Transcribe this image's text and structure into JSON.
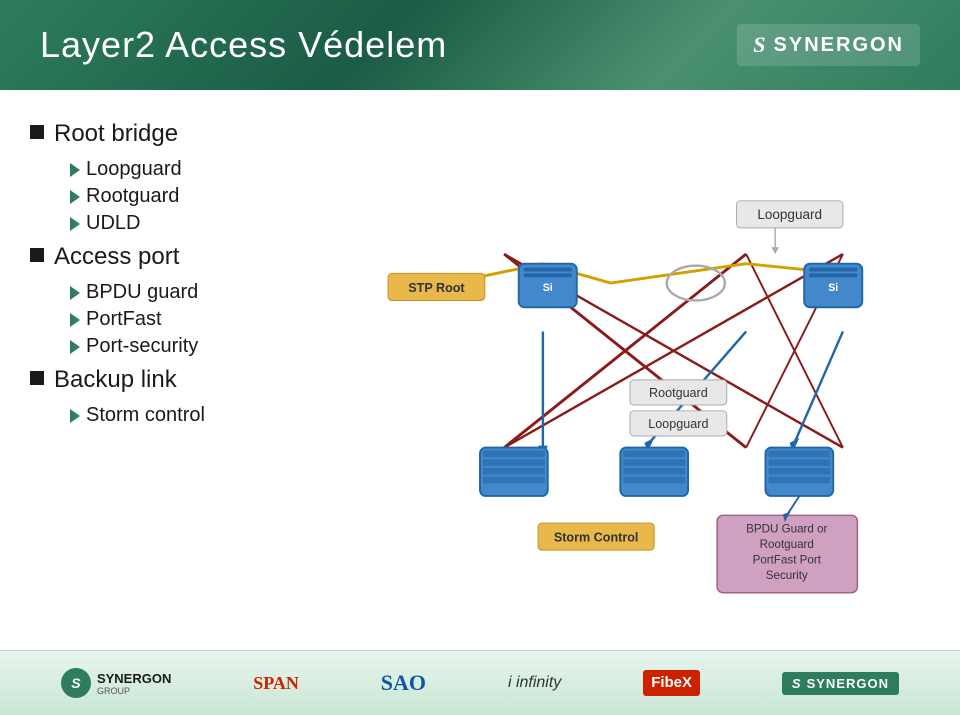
{
  "header": {
    "title": "Layer2 Access Védelem",
    "logo_text": "SYNERGON"
  },
  "content": {
    "bullet1": {
      "label": "Root bridge",
      "subitems": [
        "Loopguard",
        "Rootguard",
        "UDLD"
      ]
    },
    "bullet2": {
      "label": "Access port",
      "subitems": [
        "BPDU guard",
        "PortFast",
        "Port-security"
      ]
    },
    "bullet3": {
      "label": "Backup link",
      "subitems": [
        "Storm control"
      ]
    }
  },
  "diagram": {
    "labels": {
      "stp_root": "STP Root",
      "loopguard": "Loopguard",
      "rootguard": "Rootguard",
      "loopguard2": "Loopguard",
      "storm_control": "Storm Control",
      "bpdu_box": "BPDU Guard or\nRootguard\nPortFast Port\nSecurity"
    }
  },
  "footer": {
    "logos": [
      "SYNERGON GROUP",
      "SPAN",
      "SAO",
      "i infinity",
      "FibeX",
      "SYNERGON"
    ]
  }
}
